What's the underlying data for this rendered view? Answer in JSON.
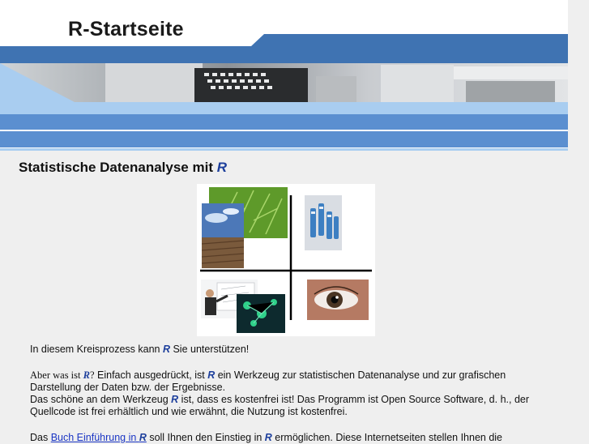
{
  "header": {
    "site_title": "R-Startseite"
  },
  "main": {
    "heading": "Statistische Datenanalyse mit",
    "heading_r": "R",
    "intro": {
      "before": "In diesem Kreisprozess kann ",
      "r": "R",
      "after": " Sie unterstützen!"
    },
    "para2": {
      "q_start": "Aber was ist ",
      "q_r": "R",
      "q_end": "?",
      "s1": " Einfach ausgedrückt, ist ",
      "s1_r": "R",
      "s1_end": " ein Werkzeug zur statistischen Datenanalyse und zur grafischen Darstellung der Daten bzw. der Ergebnisse.",
      "s2": "Das schöne an dem Werkzeug ",
      "s2_r": "R",
      "s2_end": " ist, dass es kostenfrei ist! Das Programm ist Open Source Software, d. h., der Quellcode ist frei erhältlich und wie erwähnt, die Nutzung ist kostenfrei."
    },
    "para3": {
      "before": "Das ",
      "link": "Buch Einführung in ",
      "link_r": "R",
      "mid": " soll Ihnen den Einstieg in ",
      "mid_r": "R",
      "after": " ermöglichen. Diese Internetseiten stellen Ihnen die"
    }
  },
  "colors": {
    "band_dark": "#3f73b2",
    "band_mid": "#5b8fd0",
    "band_light": "#a9cdf0",
    "r_blue": "#1d3f9c",
    "link": "#1a35c4",
    "page_bg": "#efefef"
  }
}
